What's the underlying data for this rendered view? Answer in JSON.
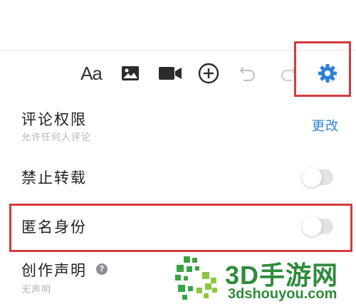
{
  "toolbar": {
    "font_label": "Aa",
    "items": [
      "font-format",
      "image",
      "video",
      "add",
      "undo",
      "redo",
      "settings"
    ]
  },
  "settings": {
    "comment_permission": {
      "title": "评论权限",
      "subtitle": "允许任何人评论",
      "action": "更改"
    },
    "no_repost": {
      "title": "禁止转载",
      "enabled": false
    },
    "anonymous": {
      "title": "匿名身份",
      "enabled": false
    },
    "creation_statement": {
      "title": "创作声明",
      "subtitle": "无声明",
      "help": "?"
    }
  },
  "watermark": {
    "title": "3D手游网",
    "subtitle": "3dshouyou.com"
  },
  "colors": {
    "accent": "#2f7fd6",
    "highlight": "#d43b3b",
    "watermark": "#2f8b3a"
  }
}
